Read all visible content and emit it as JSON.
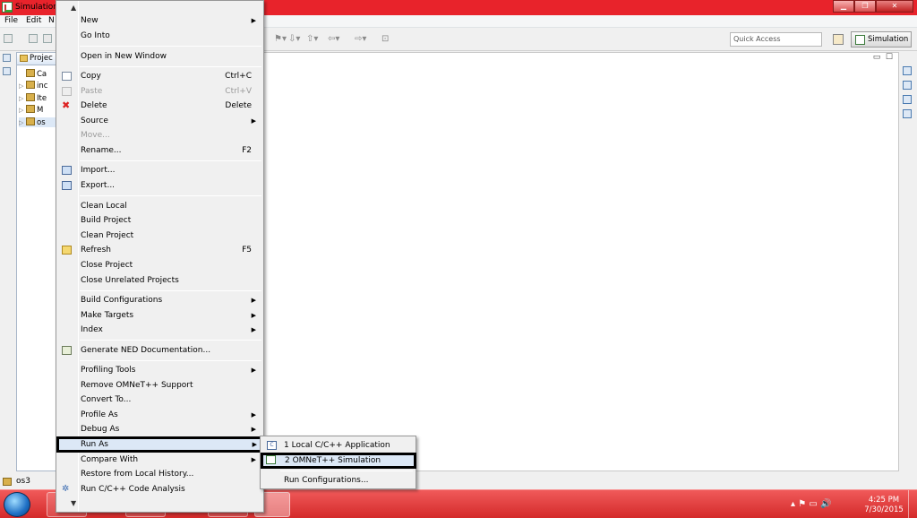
{
  "window": {
    "title": "Simulation -"
  },
  "menubar": {
    "file": "File",
    "edit": "Edit",
    "navigate": "N"
  },
  "toolbar": {
    "quick_access_placeholder": "Quick Access",
    "perspective_label": "Simulation"
  },
  "project_view": {
    "tab_label": "Projec",
    "items": [
      {
        "label": "Ca"
      },
      {
        "label": "inc"
      },
      {
        "label": "Ite"
      },
      {
        "label": "M"
      },
      {
        "label": "os"
      }
    ]
  },
  "status": {
    "selection": "os3"
  },
  "context_menu": {
    "items": [
      {
        "label": "New",
        "shortcut": "",
        "submenu": true
      },
      {
        "label": "Go Into",
        "shortcut": ""
      },
      {
        "label": "Open in New Window",
        "shortcut": ""
      },
      {
        "label": "Copy",
        "shortcut": "Ctrl+C"
      },
      {
        "label": "Paste",
        "shortcut": "Ctrl+V",
        "disabled": true
      },
      {
        "label": "Delete",
        "shortcut": "Delete"
      },
      {
        "label": "Source",
        "shortcut": "",
        "submenu": true
      },
      {
        "label": "Move...",
        "shortcut": "",
        "disabled": true
      },
      {
        "label": "Rename...",
        "shortcut": "F2"
      },
      {
        "label": "Import...",
        "shortcut": ""
      },
      {
        "label": "Export...",
        "shortcut": ""
      },
      {
        "label": "Clean Local",
        "shortcut": ""
      },
      {
        "label": "Build Project",
        "shortcut": ""
      },
      {
        "label": "Clean Project",
        "shortcut": ""
      },
      {
        "label": "Refresh",
        "shortcut": "F5"
      },
      {
        "label": "Close Project",
        "shortcut": ""
      },
      {
        "label": "Close Unrelated Projects",
        "shortcut": ""
      },
      {
        "label": "Build Configurations",
        "shortcut": "",
        "submenu": true
      },
      {
        "label": "Make Targets",
        "shortcut": "",
        "submenu": true
      },
      {
        "label": "Index",
        "shortcut": "",
        "submenu": true
      },
      {
        "label": "Generate NED Documentation...",
        "shortcut": ""
      },
      {
        "label": "Profiling Tools",
        "shortcut": "",
        "submenu": true
      },
      {
        "label": "Remove OMNeT++ Support",
        "shortcut": ""
      },
      {
        "label": "Convert To...",
        "shortcut": ""
      },
      {
        "label": "Profile As",
        "shortcut": "",
        "submenu": true
      },
      {
        "label": "Debug As",
        "shortcut": "",
        "submenu": true
      },
      {
        "label": "Run As",
        "shortcut": "",
        "submenu": true,
        "highlighted": true
      },
      {
        "label": "Compare With",
        "shortcut": "",
        "submenu": true
      },
      {
        "label": "Restore from Local History...",
        "shortcut": ""
      },
      {
        "label": "Run C/C++ Code Analysis",
        "shortcut": ""
      }
    ]
  },
  "run_as_submenu": {
    "items": [
      {
        "label": "1 Local C/C++ Application",
        "icon_letter": "C"
      },
      {
        "label": "2 OMNeT++ Simulation",
        "highlighted": true
      },
      {
        "label": "Run Configurations..."
      }
    ]
  },
  "taskbar": {
    "time": "4:25 PM",
    "date": "7/30/2015"
  }
}
